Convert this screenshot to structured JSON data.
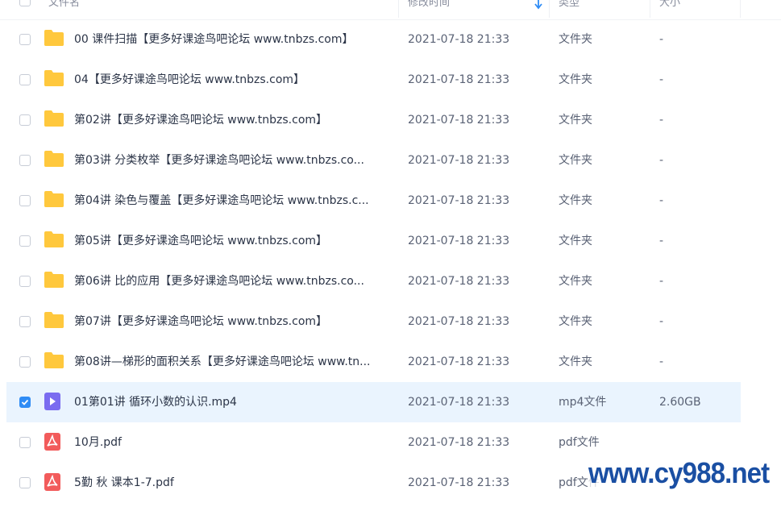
{
  "header": {
    "name_label": "文件名",
    "time_label": "修改时间",
    "type_label": "类型",
    "size_label": "大小",
    "sort_icon": "sort-down-arrow-icon"
  },
  "rows": [
    {
      "name": "00 课件扫描【更多好课途鸟吧论坛 www.tnbzs.com】",
      "time": "2021-07-18 21:33",
      "type": "文件夹",
      "size": "-",
      "icon": "folder",
      "checked": false
    },
    {
      "name": "04【更多好课途鸟吧论坛 www.tnbzs.com】",
      "time": "2021-07-18 21:33",
      "type": "文件夹",
      "size": "-",
      "icon": "folder",
      "checked": false
    },
    {
      "name": "第02讲【更多好课途鸟吧论坛 www.tnbzs.com】",
      "time": "2021-07-18 21:33",
      "type": "文件夹",
      "size": "-",
      "icon": "folder",
      "checked": false
    },
    {
      "name": "第03讲 分类枚举【更多好课途鸟吧论坛 www.tnbzs.co...",
      "time": "2021-07-18 21:33",
      "type": "文件夹",
      "size": "-",
      "icon": "folder",
      "checked": false
    },
    {
      "name": "第04讲 染色与覆盖【更多好课途鸟吧论坛 www.tnbzs.c...",
      "time": "2021-07-18 21:33",
      "type": "文件夹",
      "size": "-",
      "icon": "folder",
      "checked": false
    },
    {
      "name": "第05讲【更多好课途鸟吧论坛 www.tnbzs.com】",
      "time": "2021-07-18 21:33",
      "type": "文件夹",
      "size": "-",
      "icon": "folder",
      "checked": false
    },
    {
      "name": "第06讲 比的应用【更多好课途鸟吧论坛 www.tnbzs.co...",
      "time": "2021-07-18 21:33",
      "type": "文件夹",
      "size": "-",
      "icon": "folder",
      "checked": false
    },
    {
      "name": "第07讲【更多好课途鸟吧论坛 www.tnbzs.com】",
      "time": "2021-07-18 21:33",
      "type": "文件夹",
      "size": "-",
      "icon": "folder",
      "checked": false
    },
    {
      "name": "第08讲—梯形的面积关系【更多好课途鸟吧论坛 www.tn...",
      "time": "2021-07-18 21:33",
      "type": "文件夹",
      "size": "-",
      "icon": "folder",
      "checked": false
    },
    {
      "name": "01第01讲 循环小数的认识.mp4",
      "time": "2021-07-18 21:33",
      "type": "mp4文件",
      "size": "2.60GB",
      "icon": "video",
      "checked": true
    },
    {
      "name": "10月.pdf",
      "time": "2021-07-18 21:33",
      "type": "pdf文件",
      "size": "",
      "icon": "pdf",
      "checked": false
    },
    {
      "name": "5勤 秋  课本1-7.pdf",
      "time": "2021-07-18 21:33",
      "type": "pdf文件",
      "size": "",
      "icon": "pdf",
      "checked": false
    }
  ],
  "watermark": "www.cy988.net",
  "colors": {
    "folder": "#ffc83d",
    "video": "#7a6cf0",
    "pdf": "#f25b5b",
    "accent": "#2f8cf5",
    "selected_row": "#eaf4fe"
  }
}
